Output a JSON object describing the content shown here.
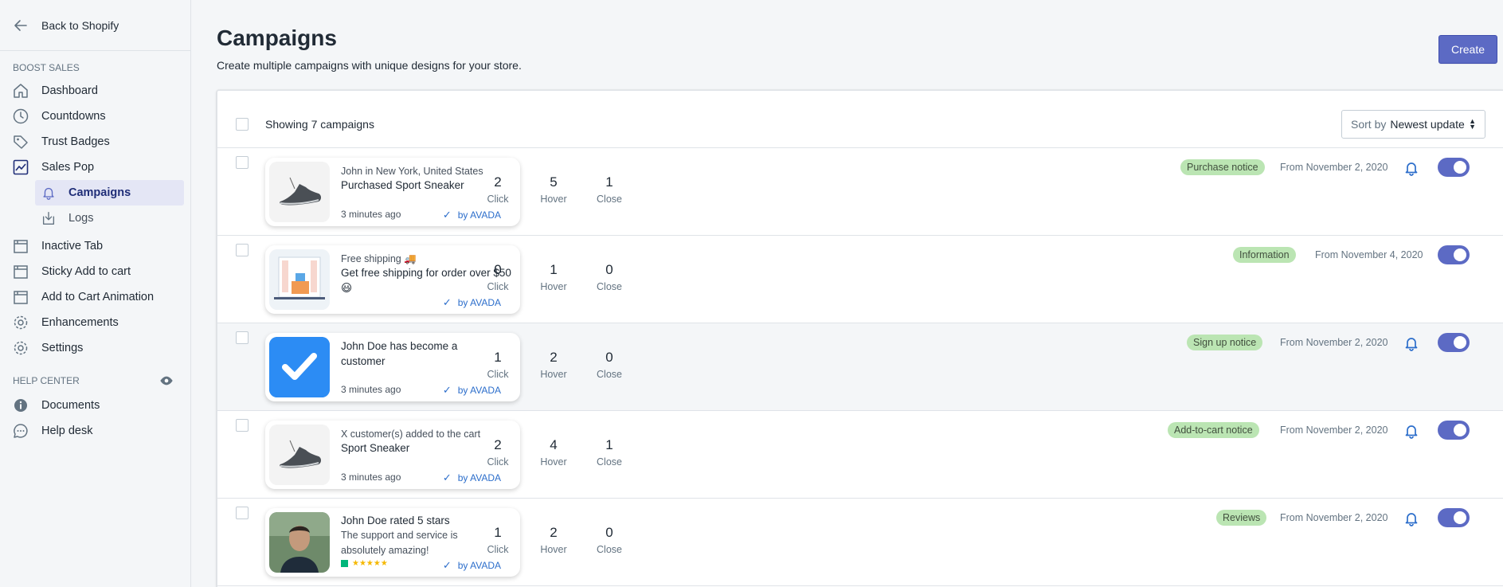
{
  "sidebar": {
    "back_label": "Back to Shopify",
    "boost_title": "BOOST SALES",
    "items": [
      {
        "label": "Dashboard",
        "icon": "home-icon"
      },
      {
        "label": "Countdowns",
        "icon": "clock-icon"
      },
      {
        "label": "Trust Badges",
        "icon": "tag-icon"
      },
      {
        "label": "Sales Pop",
        "icon": "chart-icon"
      }
    ],
    "sub_items": [
      {
        "label": "Campaigns",
        "icon": "bell-icon",
        "active": true
      },
      {
        "label": "Logs",
        "icon": "import-icon"
      }
    ],
    "items2": [
      {
        "label": "Inactive Tab",
        "icon": "window-icon"
      },
      {
        "label": "Sticky Add to cart",
        "icon": "window-icon"
      },
      {
        "label": "Add to Cart Animation",
        "icon": "window-icon"
      },
      {
        "label": "Enhancements",
        "icon": "gear-icon"
      },
      {
        "label": "Settings",
        "icon": "gear-icon"
      }
    ],
    "help_title": "HELP CENTER",
    "help_items": [
      {
        "label": "Documents",
        "icon": "info-icon"
      },
      {
        "label": "Help desk",
        "icon": "chat-icon"
      }
    ]
  },
  "header": {
    "title": "Campaigns",
    "subtitle": "Create multiple campaigns with unique designs for your store.",
    "create_label": "Create"
  },
  "list": {
    "showing": "Showing 7 campaigns",
    "sort_key": "Sort by",
    "sort_value": "Newest update",
    "by_label": "by AVADA",
    "stat_labels": [
      "Click",
      "Hover",
      "Close"
    ]
  },
  "campaigns": [
    {
      "line1": "John in New York, United States",
      "line2": "Purchased Sport Sneaker",
      "time": "3 minutes ago",
      "thumb": "sneaker",
      "stats": [
        "2",
        "5",
        "1"
      ],
      "badge": "Purchase notice",
      "date": "From November 2, 2020",
      "bell": true
    },
    {
      "line1": "Free shipping 🚚",
      "line2": "Get free shipping for order over $50 😃",
      "time": "",
      "thumb": "store",
      "stats": [
        "0",
        "1",
        "0"
      ],
      "badge": "Information",
      "date": "From November 4, 2020",
      "bell": false
    },
    {
      "line1": "",
      "line2": "John Doe has become a customer",
      "time": "3 minutes ago",
      "thumb": "check",
      "stats": [
        "1",
        "2",
        "0"
      ],
      "badge": "Sign up notice",
      "date": "From November 2, 2020",
      "bell": true
    },
    {
      "line1": "X customer(s) added to the cart",
      "line2": "Sport Sneaker",
      "time": "3 minutes ago",
      "thumb": "sneaker",
      "stats": [
        "2",
        "4",
        "1"
      ],
      "badge": "Add-to-cart notice",
      "date": "From November 2, 2020",
      "bell": true
    },
    {
      "line1": "",
      "line2": "John Doe rated 5 stars",
      "sub": "The support and service is absolutely amazing!",
      "time": "★★★★★",
      "thumb": "person",
      "stats": [
        "1",
        "2",
        "0"
      ],
      "badge": "Reviews",
      "date": "From November 2, 2020",
      "bell": true
    }
  ],
  "colors": {
    "accent": "#5c6ac4",
    "badge_bg": "#bbe5b3",
    "link": "#2c6ecb"
  }
}
